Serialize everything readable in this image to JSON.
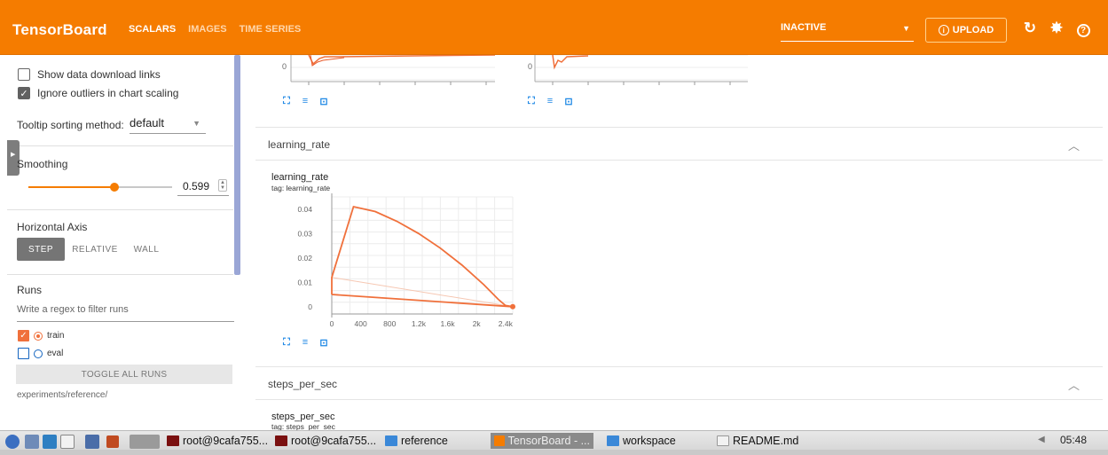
{
  "header": {
    "title": "TensorBoard",
    "tabs": [
      {
        "label": "SCALARS",
        "active": true
      },
      {
        "label": "IMAGES",
        "active": false
      },
      {
        "label": "TIME SERIES",
        "active": false
      }
    ],
    "reload_select": "INACTIVE",
    "upload_label": "UPLOAD",
    "icons": [
      "refresh-icon",
      "gear-icon",
      "help-icon"
    ],
    "accent": "#f57c00"
  },
  "sidebar": {
    "show_download_links": {
      "label": "Show data download links",
      "checked": false
    },
    "ignore_outliers": {
      "label": "Ignore outliers in chart scaling",
      "checked": true
    },
    "tooltip_label": "Tooltip sorting method:",
    "tooltip_value": "default",
    "smoothing_label": "Smoothing",
    "smoothing_value": "0.599",
    "smoothing_level": 0.599,
    "horizontal_axis_label": "Horizontal Axis",
    "axis_options": [
      {
        "label": "STEP",
        "active": true
      },
      {
        "label": "RELATIVE",
        "active": false
      },
      {
        "label": "WALL",
        "active": false
      }
    ],
    "runs_label": "Runs",
    "runs_filter_placeholder": "Write a regex to filter runs",
    "runs": [
      {
        "name": "train",
        "checked": true,
        "color": "#f0703b"
      },
      {
        "name": "eval",
        "checked": false,
        "color": "#1565c0"
      }
    ],
    "toggle_all_label": "TOGGLE ALL RUNS",
    "experiment_path": "experiments/reference/"
  },
  "main": {
    "top_charts_zero_label": "0",
    "sections": [
      {
        "title": "learning_rate",
        "card": {
          "title": "learning_rate",
          "tag": "tag: learning_rate",
          "y_ticks": [
            "0.04",
            "0.03",
            "0.02",
            "0.01",
            "0"
          ],
          "x_ticks": [
            "0",
            "400",
            "800",
            "1.2k",
            "1.6k",
            "2k",
            "2.4k"
          ]
        }
      },
      {
        "title": "steps_per_sec",
        "card": {
          "title": "steps_per_sec",
          "tag": "tag: steps_per_sec"
        }
      }
    ]
  },
  "chart_data": {
    "type": "line",
    "title": "learning_rate",
    "subtitle": "tag: learning_rate",
    "xlim": [
      0,
      2500
    ],
    "ylim": [
      -0.003,
      0.045
    ],
    "grid": true,
    "series": [
      {
        "name": "train",
        "color": "#f0703b",
        "x": [
          0,
          0,
          300,
          600,
          900,
          1200,
          1500,
          1800,
          2100,
          2300,
          2400,
          2500,
          0
        ],
        "y": [
          0.005,
          0.012,
          0.041,
          0.039,
          0.035,
          0.03,
          0.024,
          0.017,
          0.009,
          0.003,
          0.0005,
          0.0,
          0.005
        ]
      }
    ]
  },
  "taskbar": {
    "tasks": [
      {
        "label": "root@9cafa755...",
        "active": false
      },
      {
        "label": "root@9cafa755...",
        "active": false
      },
      {
        "label": "reference",
        "active": false
      },
      {
        "label": "TensorBoard - ...",
        "active": true
      },
      {
        "label": "workspace",
        "active": false
      },
      {
        "label": "README.md",
        "active": false
      }
    ],
    "clock": "05:48"
  }
}
